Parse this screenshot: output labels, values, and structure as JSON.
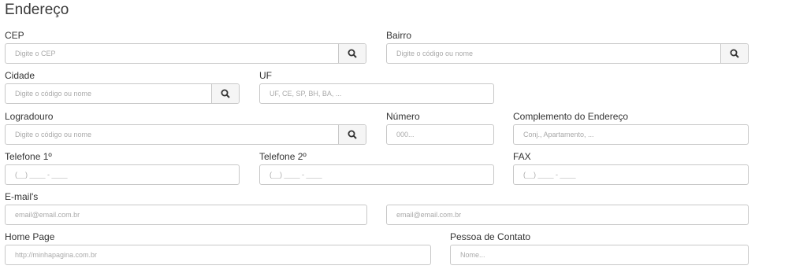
{
  "section_title": "Endereço",
  "fields": {
    "cep": {
      "label": "CEP",
      "placeholder": "Digite o CEP"
    },
    "bairro": {
      "label": "Bairro",
      "placeholder": "Digite o código ou nome"
    },
    "cidade": {
      "label": "Cidade",
      "placeholder": "Digite o código ou nome"
    },
    "uf": {
      "label": "UF",
      "placeholder": "UF, CE, SP, BH, BA, ..."
    },
    "logradouro": {
      "label": "Logradouro",
      "placeholder": "Digite o código ou nome"
    },
    "numero": {
      "label": "Número",
      "placeholder": "000..."
    },
    "complemento": {
      "label": "Complemento do Endereço",
      "placeholder": "Conj., Apartamento, ..."
    },
    "telefone1": {
      "label": "Telefone 1º",
      "placeholder": "(__) ____ - ____"
    },
    "telefone2": {
      "label": "Telefone 2º",
      "placeholder": "(__) ____ - ____"
    },
    "fax": {
      "label": "FAX",
      "placeholder": "(__) ____ - ____"
    },
    "emails": {
      "label": "E-mail's",
      "placeholder_1": "email@email.com.br",
      "placeholder_2": "email@email.com.br"
    },
    "homepage": {
      "label": "Home Page",
      "placeholder": "http://minhapagina.com.br"
    },
    "contato": {
      "label": "Pessoa de Contato",
      "placeholder": "Nome..."
    }
  },
  "icons": {
    "search_button": "search-icon"
  }
}
